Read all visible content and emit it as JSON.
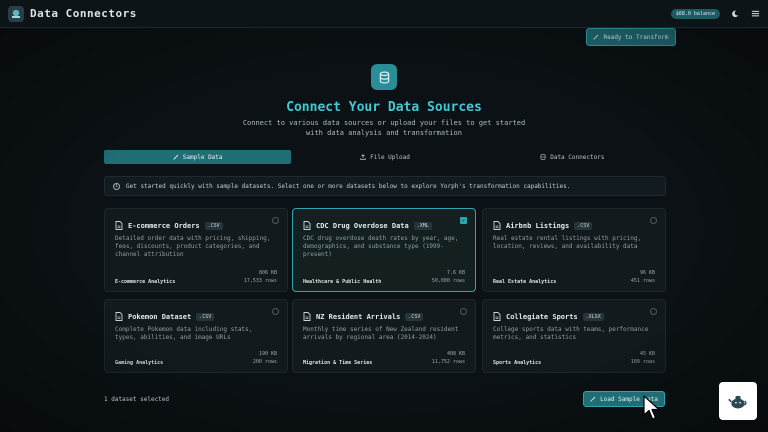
{
  "header": {
    "title": "Data Connectors",
    "balance": "$68.0 balance"
  },
  "toolbar": {
    "ready_label": "Ready to Transform"
  },
  "hero": {
    "title": "Connect Your Data Sources",
    "subtitle_line1": "Connect to various data sources or upload your files to get started",
    "subtitle_line2": "with data analysis and transformation"
  },
  "tabs": [
    {
      "label": "Sample Data",
      "active": true
    },
    {
      "label": "File Upload",
      "active": false
    },
    {
      "label": "Data Connectors",
      "active": false
    }
  ],
  "info": {
    "text": "Get started quickly with sample datasets. Select one or more datasets below to explore Yorph's transformation capabilities."
  },
  "datasets": [
    {
      "title": "E-commerce Orders",
      "format": ".CSV",
      "description": "Detailed order data with pricing, shipping, fees, discounts, product categories, and channel attribution",
      "category": "E-commerce Analytics",
      "size": "806 KB",
      "rows": "17,533 rows",
      "selected": false
    },
    {
      "title": "CDC Drug Overdose Data",
      "format": ".XML",
      "description": "CDC drug overdose death rates by year, age, demographics, and substance type (1999-present)",
      "category": "Healthcare & Public Health",
      "size": "7.6 KB",
      "rows": "50,000 rows",
      "selected": true
    },
    {
      "title": "Airbnb Listings",
      "format": ".CSV",
      "description": "Real estate rental listings with pricing, location, reviews, and availability data",
      "category": "Real Estate Analytics",
      "size": "96 KB",
      "rows": "451 rows",
      "selected": false
    },
    {
      "title": "Pokemon Dataset",
      "format": ".CSV",
      "description": "Complete Pokemon data including stats, types, abilities, and image URLs",
      "category": "Gaming Analytics",
      "size": "190 KB",
      "rows": "200 rows",
      "selected": false
    },
    {
      "title": "NZ Resident Arrivals",
      "format": ".CSV",
      "description": "Monthly time series of New Zealand resident arrivals by regional area (2014-2024)",
      "category": "Migration & Time Series",
      "size": "408 KB",
      "rows": "11,752 rows",
      "selected": false
    },
    {
      "title": "Collegiate Sports",
      "format": ".XLSX",
      "description": "College sports data with teams, performance metrics, and statistics",
      "category": "Sports Analytics",
      "size": "45 KB",
      "rows": "109 rows",
      "selected": false
    }
  ],
  "footer": {
    "selected_count": "1 dataset selected",
    "load_label": "Load Sample Data"
  },
  "colors": {
    "accent": "#2fa3ae",
    "title": "#41c9d4",
    "background": "#0b1114"
  }
}
